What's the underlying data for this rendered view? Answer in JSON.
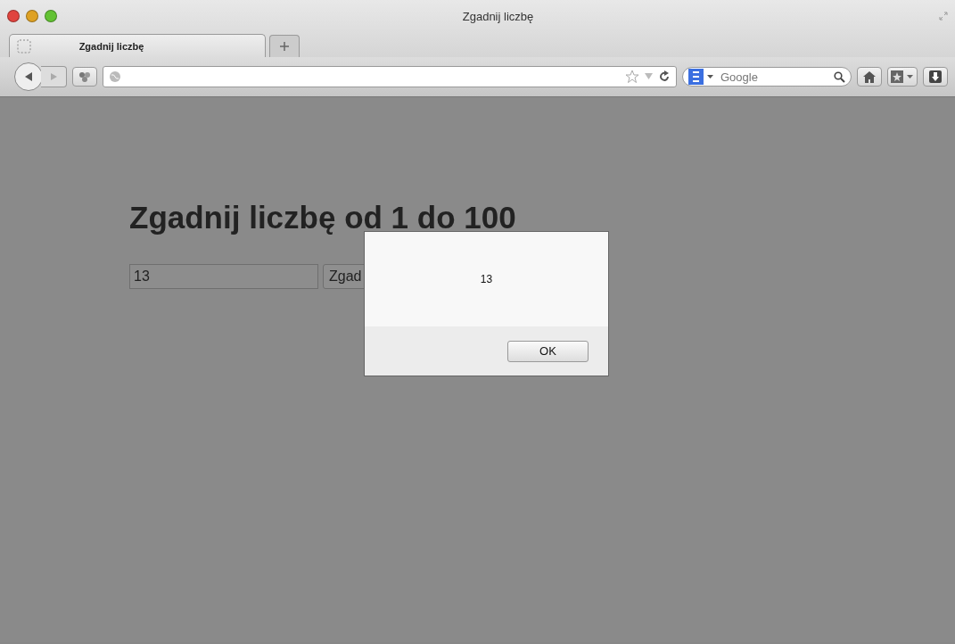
{
  "window": {
    "title": "Zgadnij liczbę"
  },
  "tabs": [
    {
      "label": "Zgadnij liczbę",
      "selected": true
    }
  ],
  "toolbar": {
    "search": {
      "placeholder": "Google"
    }
  },
  "page": {
    "heading": "Zgadnij liczbę od 1 do 100",
    "guess_input": {
      "value": "13"
    },
    "guess_button": "Zgad"
  },
  "dialog": {
    "message": "13",
    "button": "OK"
  }
}
